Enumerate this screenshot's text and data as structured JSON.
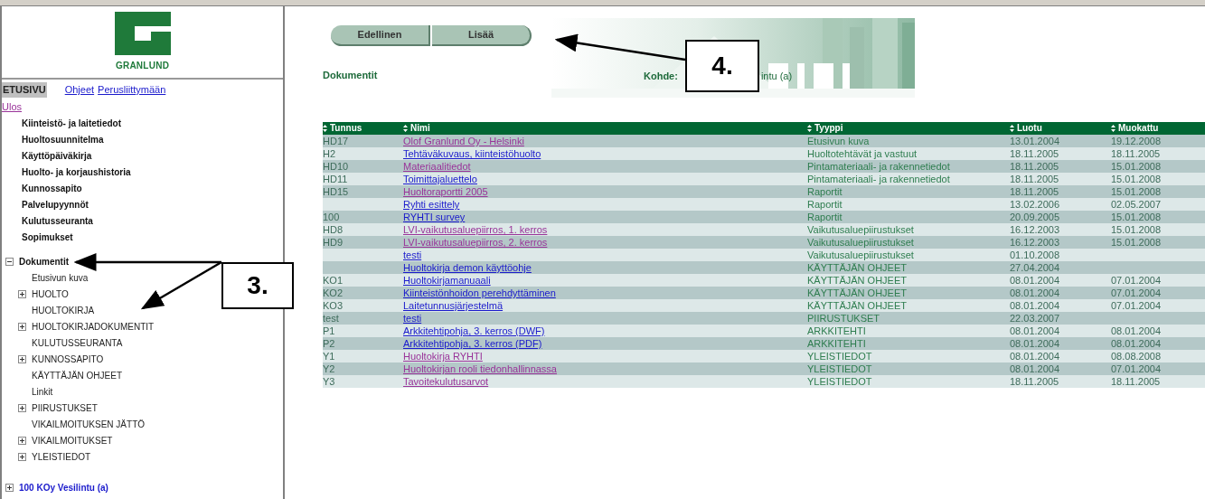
{
  "sidebar": {
    "logo": {
      "text": "GRANLUND"
    },
    "top_links": [
      {
        "label": "ETUSIVU",
        "kind": "current"
      },
      {
        "label": "Ohjeet",
        "kind": "link",
        "visited": false
      },
      {
        "label": "Perusliittymään",
        "kind": "link",
        "visited": false
      }
    ],
    "logout": {
      "label": "Ulos",
      "visited": true
    },
    "menu": [
      "Kiinteistö- ja laitetiedot",
      "Huoltosuunnitelma",
      "Käyttöpäiväkirja",
      "Huolto- ja korjaushistoria",
      "Kunnossapito",
      "Palvelupyynnöt",
      "Kulutusseuranta",
      "Sopimukset"
    ],
    "tree": [
      {
        "label": "Dokumentit",
        "kind": "folder",
        "expanded": true,
        "children": [
          {
            "label": "Etusivun kuva",
            "kind": "leaf"
          },
          {
            "label": "HUOLTO",
            "kind": "folder",
            "expanded": false
          },
          {
            "label": "HUOLTOKIRJA",
            "kind": "leaf"
          },
          {
            "label": "HUOLTOKIRJADOKUMENTIT",
            "kind": "folder",
            "expanded": false
          },
          {
            "label": "KULUTUSSEURANTA",
            "kind": "leaf"
          },
          {
            "label": "KUNNOSSAPITO",
            "kind": "folder",
            "expanded": false
          },
          {
            "label": "KÄYTTÄJÄN OHJEET",
            "kind": "leaf"
          },
          {
            "label": "Linkit",
            "kind": "leaf"
          },
          {
            "label": "PIIRUSTUKSET",
            "kind": "folder",
            "expanded": false
          },
          {
            "label": "VIKAILMOITUKSEN JÄTTÖ",
            "kind": "leaf"
          },
          {
            "label": "VIKAILMOITUKSET",
            "kind": "folder",
            "expanded": false
          },
          {
            "label": "YLEISTIEDOT",
            "kind": "folder",
            "expanded": false
          }
        ]
      }
    ],
    "property": {
      "label": "100 KOy Vesilintu (a)",
      "kind": "folder",
      "expanded": false
    }
  },
  "toolbar": {
    "buttons": [
      "Edellinen",
      "Lisää"
    ]
  },
  "header": {
    "title": "Dokumentit",
    "target_label": "Kohde:",
    "target_value": "intu (a)"
  },
  "table": {
    "columns": [
      "Tunnus",
      "Nimi",
      "Tyyppi",
      "Luotu",
      "Muokattu"
    ],
    "rows": [
      {
        "code": "HD17",
        "name": "Olof Granlund Oy - Helsinki",
        "visited": true,
        "type": "Etusivun kuva",
        "created": "13.01.2004",
        "modified": "19.12.2008"
      },
      {
        "code": "H2",
        "name": "Tehtäväkuvaus, kiinteistöhuolto",
        "visited": false,
        "type": "Huoltotehtävät ja vastuut",
        "created": "18.11.2005",
        "modified": "18.11.2005"
      },
      {
        "code": "HD10",
        "name": "Materiaalitiedot",
        "visited": true,
        "type": "Pintamateriaali- ja rakennetiedot",
        "created": "18.11.2005",
        "modified": "15.01.2008"
      },
      {
        "code": "HD11",
        "name": "Toimittajaluettelo",
        "visited": false,
        "type": "Pintamateriaali- ja rakennetiedot",
        "created": "18.11.2005",
        "modified": "15.01.2008"
      },
      {
        "code": "HD15",
        "name": "Huoltoraportti 2005",
        "visited": true,
        "type": "Raportit",
        "created": "18.11.2005",
        "modified": "15.01.2008"
      },
      {
        "name": "Ryhti esittely",
        "visited": false,
        "type": "Raportit",
        "created": "13.02.2006",
        "modified": "02.05.2007"
      },
      {
        "code": "100",
        "name": "RYHTI survey",
        "visited": false,
        "type": "Raportit",
        "created": "20.09.2005",
        "modified": "15.01.2008"
      },
      {
        "code": "HD8",
        "name": "LVI-vaikutusaluepiirros, 1. kerros",
        "visited": true,
        "type": "Vaikutusaluepiirustukset",
        "created": "16.12.2003",
        "modified": "15.01.2008"
      },
      {
        "code": "HD9",
        "name": "LVI-vaikutusaluepiirros, 2. kerros",
        "visited": true,
        "type": "Vaikutusaluepiirustukset",
        "created": "16.12.2003",
        "modified": "15.01.2008"
      },
      {
        "name": "testi",
        "visited": false,
        "type": "Vaikutusaluepiirustukset",
        "created": "01.10.2008"
      },
      {
        "name": "Huoltokirja demon käyttöohje",
        "visited": false,
        "type": "KÄYTTÄJÄN OHJEET",
        "created": "27.04.2004"
      },
      {
        "code": "KO1",
        "name": "Huoltokirjamanuaali",
        "visited": false,
        "type": "KÄYTTÄJÄN OHJEET",
        "created": "08.01.2004",
        "modified": "07.01.2004"
      },
      {
        "code": "KO2",
        "name": "Kiinteistönhoidon perehdyttäminen",
        "visited": false,
        "type": "KÄYTTÄJÄN OHJEET",
        "created": "08.01.2004",
        "modified": "07.01.2004"
      },
      {
        "code": "KO3",
        "name": "Laitetunnusjärjestelmä",
        "visited": false,
        "type": "KÄYTTÄJÄN OHJEET",
        "created": "08.01.2004",
        "modified": "07.01.2004"
      },
      {
        "code": "test",
        "name": "testi",
        "visited": false,
        "type": "PIIRUSTUKSET",
        "created": "22.03.2007"
      },
      {
        "code": "P1",
        "name": "Arkkitehtipohja, 3. kerros (DWF)",
        "visited": false,
        "type": "ARKKITEHTI",
        "created": "08.01.2004",
        "modified": "08.01.2004"
      },
      {
        "code": "P2",
        "name": "Arkkitehtipohja, 3. kerros (PDF)",
        "visited": false,
        "type": "ARKKITEHTI",
        "created": "08.01.2004",
        "modified": "08.01.2004"
      },
      {
        "code": "Y1",
        "name": "Huoltokirja RYHTI",
        "visited": true,
        "type": "YLEISTIEDOT",
        "created": "08.01.2004",
        "modified": "08.08.2008"
      },
      {
        "code": "Y2",
        "name": "Huoltokirjan rooli tiedonhallinnassa",
        "visited": true,
        "type": "YLEISTIEDOT",
        "created": "08.01.2004",
        "modified": "07.01.2004"
      },
      {
        "code": "Y3",
        "name": "Tavoitekulutusarvot",
        "visited": true,
        "type": "YLEISTIEDOT",
        "created": "18.11.2005",
        "modified": "18.11.2005"
      }
    ]
  },
  "callouts": [
    {
      "label": "3."
    },
    {
      "label": "4."
    }
  ]
}
